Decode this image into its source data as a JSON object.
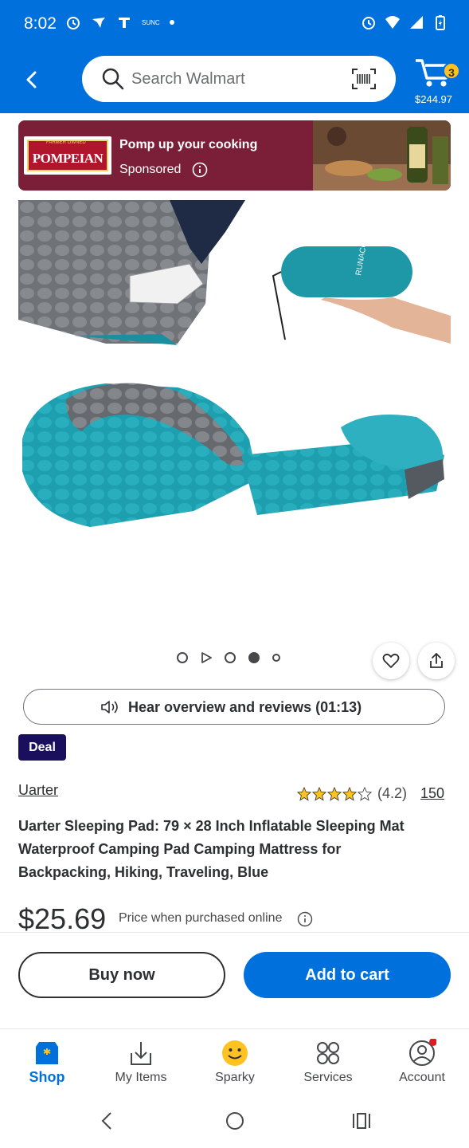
{
  "status_bar": {
    "time": "8:02",
    "carrier_label": "SUNC"
  },
  "header": {
    "search_placeholder": "Search Walmart",
    "cart_count": "3",
    "cart_total": "$244.97",
    "colors": {
      "brand_blue": "#0071dc",
      "badge_yellow": "#ffc220"
    }
  },
  "ad": {
    "brand_logo": "POMPEIAN",
    "brand_logo_top": "FARMER OWNED",
    "headline": "Pomp up your cooking",
    "sponsored_label": "Sponsored"
  },
  "gallery": {
    "item_count": 5,
    "active_index": 3
  },
  "overview_button": {
    "label": "Hear overview and reviews (01:13)"
  },
  "product": {
    "deal_badge": "Deal",
    "brand": "Uarter",
    "rating_value": "(4.2)",
    "rating_stars": 4.2,
    "review_count": "150",
    "title": "Uarter Sleeping Pad: 79 × 28 Inch Inflatable Sleeping Mat Waterproof Camping Pad Camping Mattress for Backpacking, Hiking, Traveling, Blue",
    "price": "$25.69",
    "price_note": "Price when purchased online"
  },
  "actions": {
    "buy_now": "Buy now",
    "add_to_cart": "Add to cart"
  },
  "bottom_nav": {
    "items": [
      {
        "label": "Shop",
        "icon": "store-icon",
        "active": true
      },
      {
        "label": "My Items",
        "icon": "download-tray-icon",
        "active": false
      },
      {
        "label": "Sparky",
        "icon": "smiley-icon",
        "active": false
      },
      {
        "label": "Services",
        "icon": "grid-circles-icon",
        "active": false
      },
      {
        "label": "Account",
        "icon": "user-circle-icon",
        "active": false
      }
    ]
  }
}
